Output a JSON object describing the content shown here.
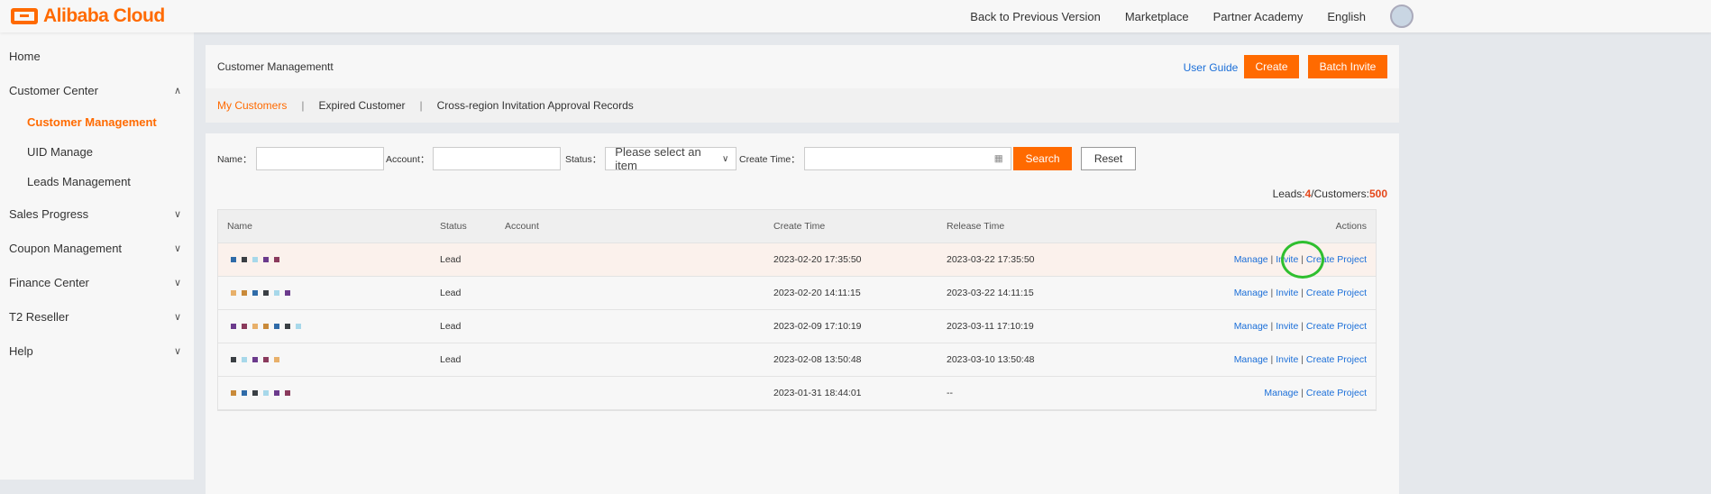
{
  "header": {
    "logo": "Alibaba Cloud",
    "nav": [
      "Back to Previous Version",
      "Marketplace",
      "Partner Academy",
      "English"
    ]
  },
  "sidebar": {
    "items": [
      {
        "label": "Home",
        "type": "top"
      },
      {
        "label": "Customer Center",
        "type": "top",
        "chev": "^"
      },
      {
        "label": "Customer Management",
        "type": "sub",
        "active": true
      },
      {
        "label": "UID Manage",
        "type": "sub"
      },
      {
        "label": "Leads Management",
        "type": "sub"
      },
      {
        "label": "Sales Progress",
        "type": "top",
        "chev": "v"
      },
      {
        "label": "Coupon Management",
        "type": "top",
        "chev": "v"
      },
      {
        "label": "Finance Center",
        "type": "top",
        "chev": "v"
      },
      {
        "label": "T2 Reseller",
        "type": "top",
        "chev": "v"
      },
      {
        "label": "Help",
        "type": "top",
        "chev": "v"
      }
    ]
  },
  "page": {
    "title": "Customer Managementt",
    "user_guide": "User Guide",
    "create": "Create",
    "batch_invite": "Batch Invite",
    "tabs": [
      "My Customers",
      "Expired Customer",
      "Cross-region Invitation Approval Records"
    ]
  },
  "filters": {
    "name": "Name：",
    "account": "Account：",
    "status": "Status：",
    "status_placeholder": "Please select an item",
    "create_time": "Create Time：",
    "search": "Search",
    "reset": "Reset"
  },
  "summary": {
    "leads_label": "Leads:",
    "leads": "4",
    "customers_label": "/Customers:",
    "customers": "500"
  },
  "table": {
    "headers": [
      "Name",
      "Status",
      "Account",
      "Create Time",
      "Release Time",
      "Actions"
    ],
    "rows": [
      {
        "status": "Lead",
        "create": "2023-02-20 17:35:50",
        "release": "2023-03-22 17:35:50",
        "actions": [
          "Manage",
          "Invite",
          "Create Project"
        ]
      },
      {
        "status": "Lead",
        "create": "2023-02-20 14:11:15",
        "release": "2023-03-22 14:11:15",
        "actions": [
          "Manage",
          "Invite",
          "Create Project"
        ]
      },
      {
        "status": "Lead",
        "create": "2023-02-09 17:10:19",
        "release": "2023-03-11 17:10:19",
        "actions": [
          "Manage",
          "Invite",
          "Create Project"
        ]
      },
      {
        "status": "Lead",
        "create": "2023-02-08 13:50:48",
        "release": "2023-03-10 13:50:48",
        "actions": [
          "Manage",
          "Invite",
          "Create Project"
        ]
      },
      {
        "status": "",
        "create": "2023-01-31 18:44:01",
        "release": "--",
        "actions": [
          "Manage",
          "Create Project"
        ]
      }
    ]
  },
  "colors": {
    "accent": "#ff6a00",
    "link": "#1a6ed8",
    "highlight": "#2fbf2f"
  }
}
